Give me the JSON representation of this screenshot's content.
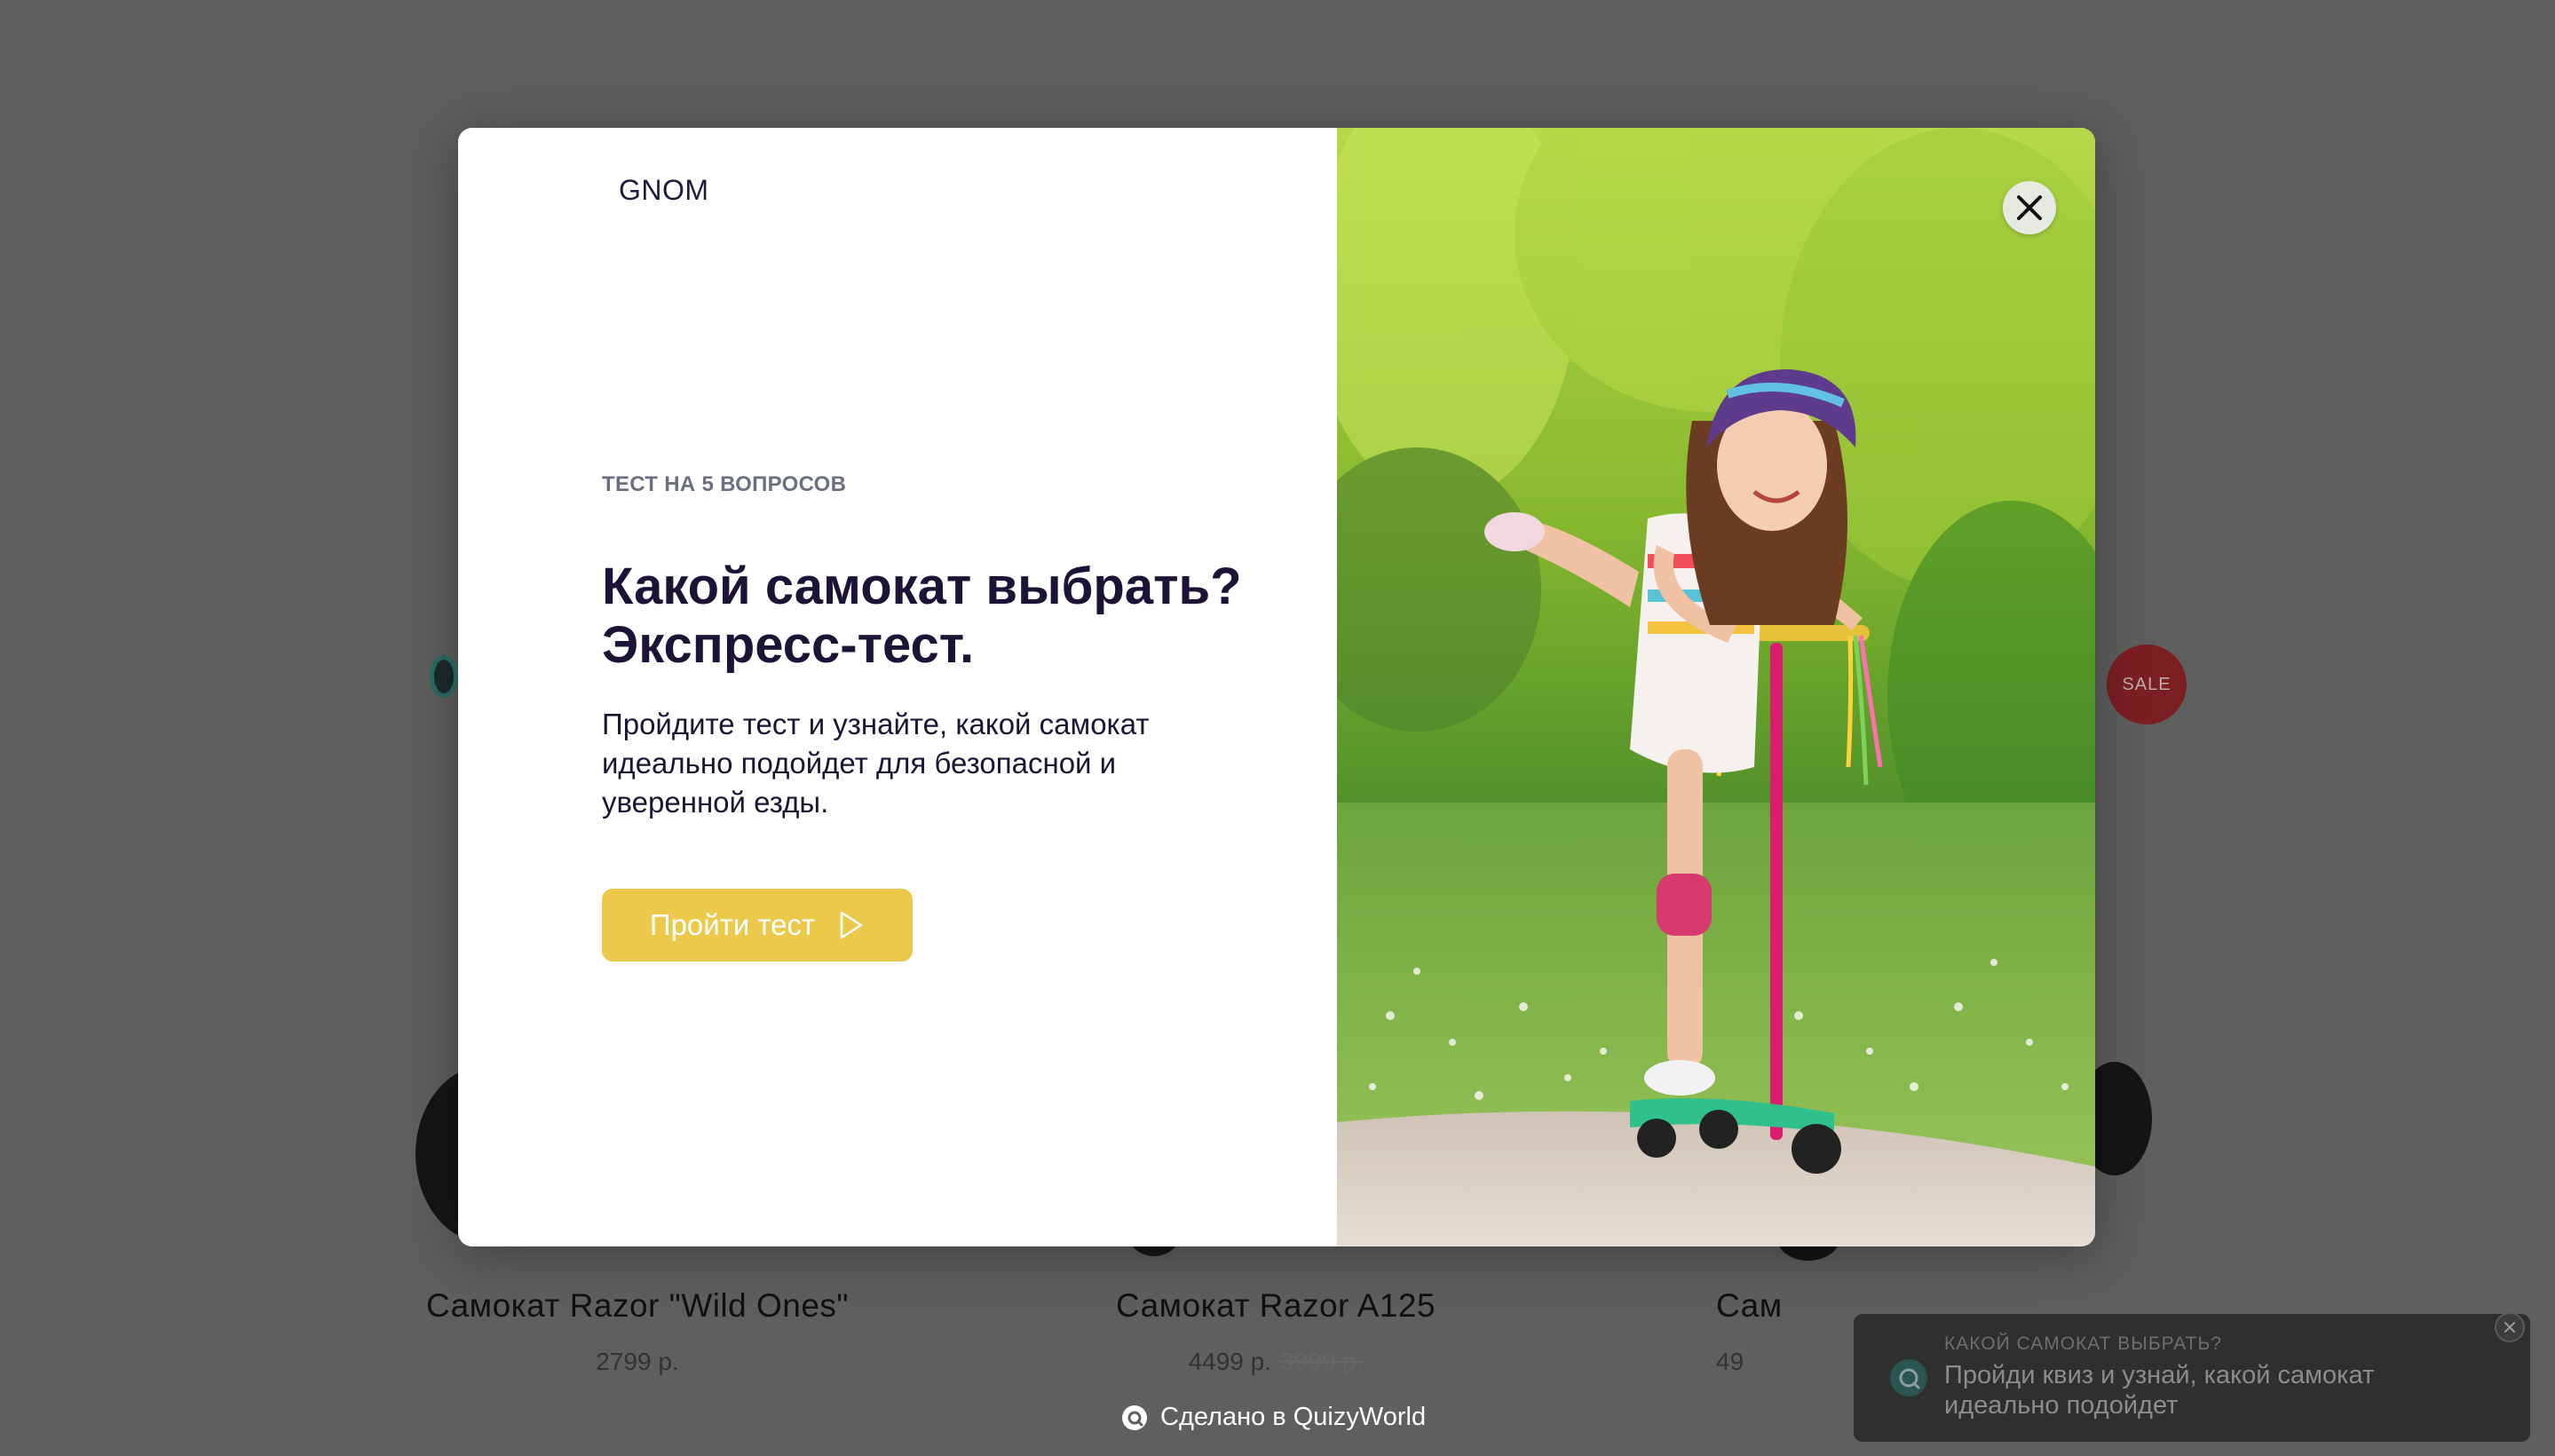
{
  "background": {
    "sale_badge": "SALE",
    "products": [
      {
        "name": "Самокат Razor \"Wild Ones\"",
        "price": "2799 р.",
        "old_price": ""
      },
      {
        "name": "Самокат Razor A125",
        "price": "4499 р.",
        "old_price": "3999 р."
      },
      {
        "name": "Сам",
        "price": "49",
        "old_price": ""
      }
    ]
  },
  "modal": {
    "logo": "GNOM",
    "eyebrow": "ТЕСТ НА 5 ВОПРОСОВ",
    "headline_line1": "Какой самокат выбрать?",
    "headline_line2": "Экспресс-тест.",
    "description": "Пройдите тест и узнайте, какой самокат идеально подойдет для безопасной и уверенной езды.",
    "start_button": "Пройти тест",
    "image_alt": "girl riding pink kick scooter in park",
    "close_icon": "close-icon"
  },
  "footer": {
    "made_with": "Сделано в QuizyWorld"
  },
  "toast": {
    "title": "КАКОЙ САМОКАТ ВЫБРАТЬ?",
    "text": "Пройди квиз и узнай, какой самокат идеально подойдет"
  },
  "colors": {
    "overlay": "#5f5f5f",
    "accent_button": "#ecc94b",
    "headline": "#1d1336",
    "eyebrow": "#6b6f80"
  }
}
